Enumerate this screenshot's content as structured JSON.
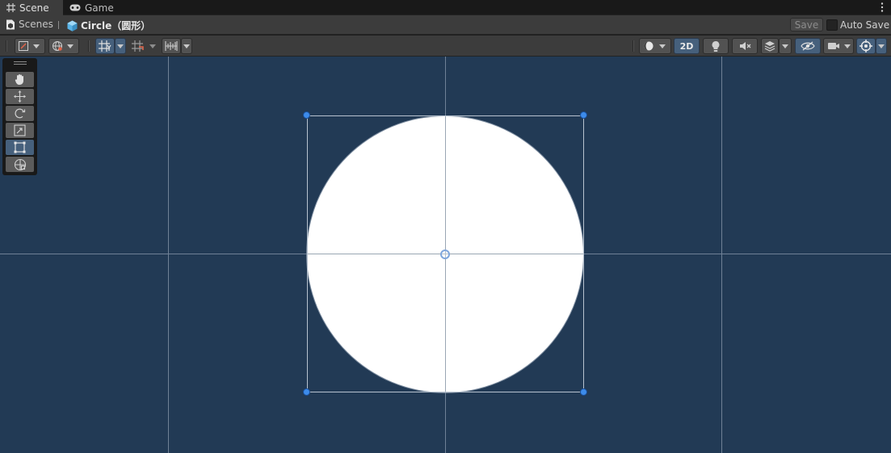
{
  "tabs": [
    {
      "label": "Scene",
      "icon": "grid-hash-icon",
      "active": true
    },
    {
      "label": "Game",
      "icon": "gamepad-icon",
      "active": false
    }
  ],
  "breadcrumb": {
    "root": "Scenes",
    "current": "Circle（圆形）"
  },
  "header": {
    "save_label": "Save",
    "autosave_label": "Auto Save"
  },
  "toolbar": {
    "mode_2d_label": "2D"
  },
  "colors": {
    "viewport_bg": "#223a55",
    "accent": "#46607c",
    "handle": "#3d8bea",
    "sprite": "#ffffff"
  },
  "tools": [
    "hand-tool",
    "move-tool",
    "rotate-tool",
    "scale-tool",
    "rect-tool",
    "transform-tool"
  ],
  "active_tool": "rect-tool"
}
